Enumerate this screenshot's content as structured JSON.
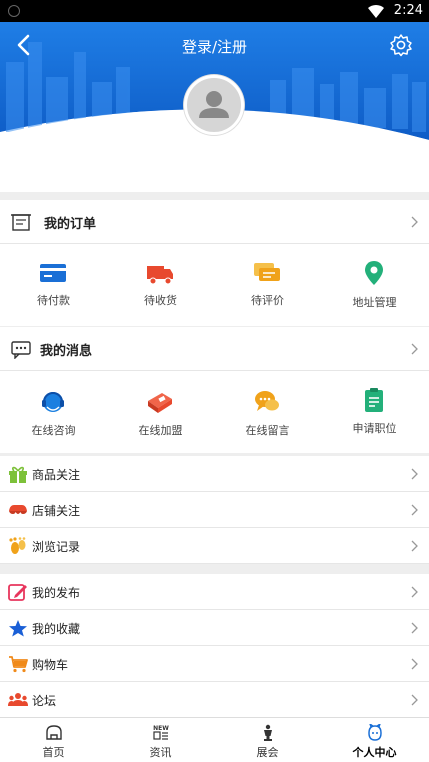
{
  "status_bar": {
    "time": "2:24"
  },
  "header": {
    "title": "登录/注册",
    "back_icon": "chevron-left-icon",
    "settings_icon": "gear-icon"
  },
  "orders": {
    "title": "我的订单",
    "items": [
      {
        "label": "待付款",
        "icon": "payment-card-icon",
        "color": "#1a6fd6"
      },
      {
        "label": "待收货",
        "icon": "delivery-truck-icon",
        "color": "#e8492e"
      },
      {
        "label": "待评价",
        "icon": "comment-stack-icon",
        "color": "#f0a21a"
      },
      {
        "label": "地址管理",
        "icon": "location-pin-icon",
        "color": "#23b07a"
      }
    ]
  },
  "messages": {
    "title": "我的消息",
    "items": [
      {
        "label": "在线咨询",
        "icon": "headset-icon",
        "color": "#1a7fe0"
      },
      {
        "label": "在线加盟",
        "icon": "join-box-icon",
        "color": "#e8492e"
      },
      {
        "label": "在线留言",
        "icon": "chat-bubbles-icon",
        "color": "#f0a21a"
      },
      {
        "label": "申请职位",
        "icon": "clipboard-icon",
        "color": "#23b07a"
      }
    ]
  },
  "list_group_1": [
    {
      "label": "商品关注",
      "icon": "gift-icon",
      "color": "#7dc13a"
    },
    {
      "label": "店铺关注",
      "icon": "shop-awning-icon",
      "color": "#e8492e"
    },
    {
      "label": "浏览记录",
      "icon": "footprint-icon",
      "color": "#f0a21a"
    }
  ],
  "list_group_2": [
    {
      "label": "我的发布",
      "icon": "edit-pen-icon",
      "color": "#e8365d"
    },
    {
      "label": "我的收藏",
      "icon": "star-icon",
      "color": "#1a5fd6"
    },
    {
      "label": "购物车",
      "icon": "shopping-cart-icon",
      "color": "#f08a1a"
    },
    {
      "label": "论坛",
      "icon": "users-group-icon",
      "color": "#e8492e"
    }
  ],
  "tabbar": [
    {
      "label": "首页",
      "icon": "home-icon"
    },
    {
      "label": "资讯",
      "icon": "news-icon"
    },
    {
      "label": "展会",
      "icon": "trophy-icon"
    },
    {
      "label": "个人中心",
      "icon": "profile-face-icon",
      "active": true
    }
  ]
}
